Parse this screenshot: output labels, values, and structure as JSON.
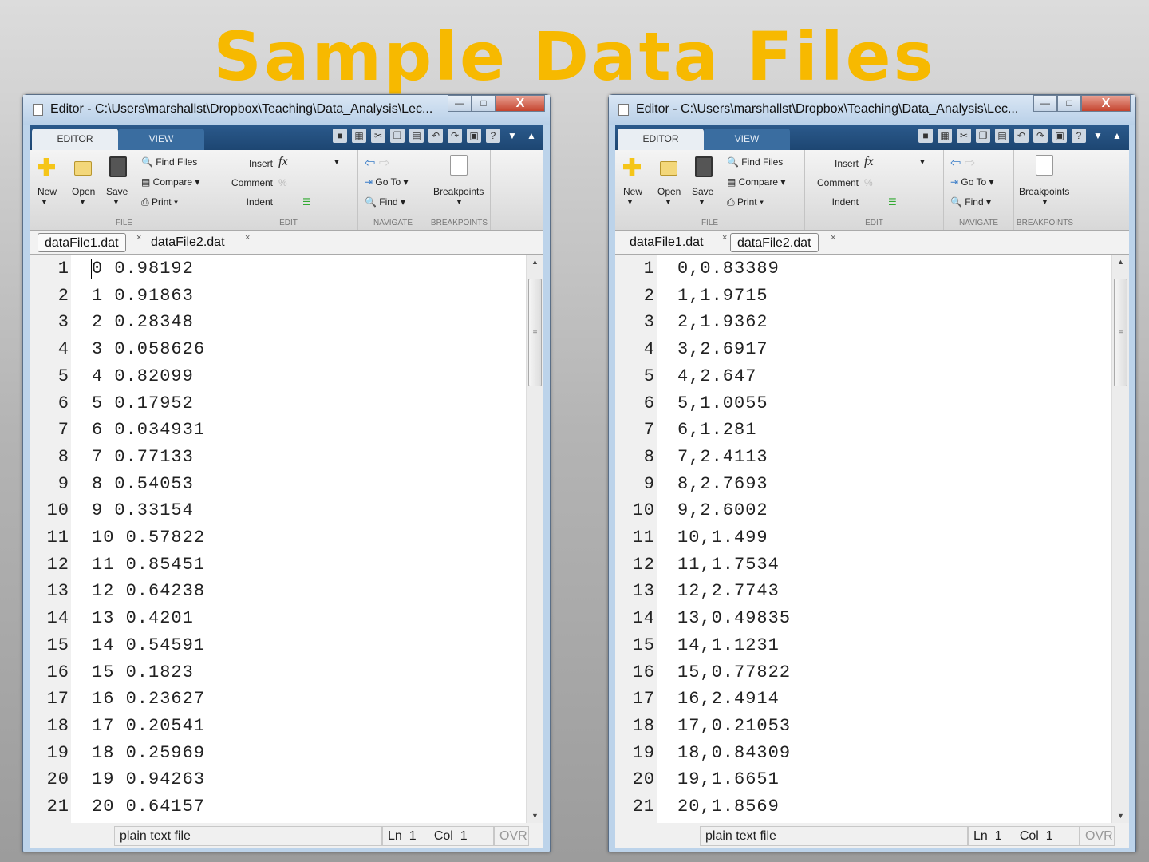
{
  "slide_title": "Sample Data Files",
  "windows": [
    {
      "title": "Editor - C:\\Users\\marshallst\\Dropbox\\Teaching\\Data_Analysis\\Lec...",
      "ribbon_tabs": [
        "EDITOR",
        "VIEW"
      ],
      "file_group": {
        "new": "New",
        "open": "Open",
        "save": "Save",
        "find_files": "Find Files",
        "compare": "Compare",
        "print": "Print",
        "label": "FILE"
      },
      "edit_group": {
        "insert": "Insert",
        "comment": "Comment",
        "indent": "Indent",
        "label": "EDIT"
      },
      "navigate_group": {
        "go_to": "Go To",
        "find": "Find",
        "label": "NAVIGATE"
      },
      "breakpoints_group": {
        "breakpoints": "Breakpoints",
        "label": "BREAKPOINTS"
      },
      "doc_tabs": [
        "dataFile1.dat",
        "dataFile2.dat"
      ],
      "active_tab": 0,
      "lines": [
        "0 0.98192",
        "1 0.91863",
        "2 0.28348",
        "3 0.058626",
        "4 0.82099",
        "5 0.17952",
        "6 0.034931",
        "7 0.77133",
        "8 0.54053",
        "9 0.33154",
        "10 0.57822",
        "11 0.85451",
        "12 0.64238",
        "13 0.4201",
        "14 0.54591",
        "15 0.1823",
        "16 0.23627",
        "17 0.20541",
        "18 0.25969",
        "19 0.94263",
        "20 0.64157"
      ],
      "status": {
        "file_type": "plain text file",
        "ln_label": "Ln",
        "ln": "1",
        "col_label": "Col",
        "col": "1",
        "ovr": "OVR"
      }
    },
    {
      "title": "Editor - C:\\Users\\marshallst\\Dropbox\\Teaching\\Data_Analysis\\Lec...",
      "ribbon_tabs": [
        "EDITOR",
        "VIEW"
      ],
      "file_group": {
        "new": "New",
        "open": "Open",
        "save": "Save",
        "find_files": "Find Files",
        "compare": "Compare",
        "print": "Print",
        "label": "FILE"
      },
      "edit_group": {
        "insert": "Insert",
        "comment": "Comment",
        "indent": "Indent",
        "label": "EDIT"
      },
      "navigate_group": {
        "go_to": "Go To",
        "find": "Find",
        "label": "NAVIGATE"
      },
      "breakpoints_group": {
        "breakpoints": "Breakpoints",
        "label": "BREAKPOINTS"
      },
      "doc_tabs": [
        "dataFile1.dat",
        "dataFile2.dat"
      ],
      "active_tab": 1,
      "lines": [
        "0,0.83389",
        "1,1.9715",
        "2,1.9362",
        "3,2.6917",
        "4,2.647",
        "5,1.0055",
        "6,1.281",
        "7,2.4113",
        "8,2.7693",
        "9,2.6002",
        "10,1.499",
        "11,1.7534",
        "12,2.7743",
        "13,0.49835",
        "14,1.1231",
        "15,0.77822",
        "16,2.4914",
        "17,0.21053",
        "18,0.84309",
        "19,1.6651",
        "20,1.8569"
      ],
      "status": {
        "file_type": "plain text file",
        "ln_label": "Ln",
        "ln": "1",
        "col_label": "Col",
        "col": "1",
        "ovr": "OVR"
      }
    }
  ]
}
